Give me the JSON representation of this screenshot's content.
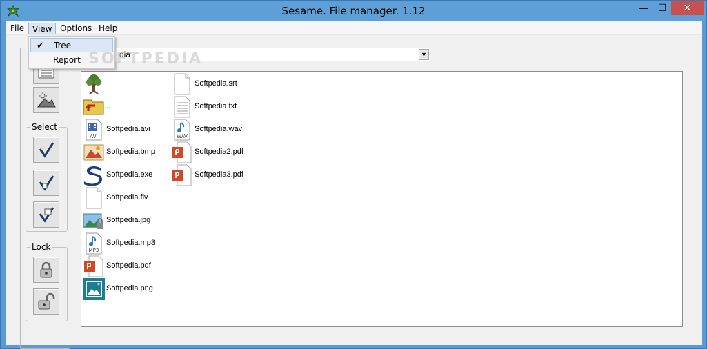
{
  "window": {
    "title": "Sesame. File manager. 1.12",
    "min_glyph": "—",
    "max_glyph": "☐",
    "close_glyph": "✕"
  },
  "menu": {
    "file": "File",
    "view": "View",
    "options": "Options",
    "help": "Help"
  },
  "view_menu": {
    "items": [
      {
        "label": "Tree",
        "checked": true,
        "highlighted": true
      },
      {
        "label": "Report",
        "checked": false,
        "highlighted": false
      }
    ],
    "check_glyph": "✔"
  },
  "sidebar": {
    "select_label": "Select",
    "lock_label": "Lock"
  },
  "path": {
    "value": "dia"
  },
  "watermark": "SOFTPEDIA",
  "files": [
    {
      "name": "",
      "icon": "tree-icon"
    },
    {
      "name": "..",
      "icon": "parent-folder-icon"
    },
    {
      "name": "Softpedia.avi",
      "icon": "avi-icon"
    },
    {
      "name": "Softpedia.bmp",
      "icon": "bmp-icon"
    },
    {
      "name": "Softpedia.exe",
      "icon": "exe-icon"
    },
    {
      "name": "Softpedia.flv",
      "icon": "blank-file-icon"
    },
    {
      "name": "Softpedia.jpg",
      "icon": "jpg-icon"
    },
    {
      "name": "Softpedia.mp3",
      "icon": "mp3-icon"
    },
    {
      "name": "Softpedia.pdf",
      "icon": "pdf-icon"
    },
    {
      "name": "Softpedia.png",
      "icon": "png-icon"
    },
    {
      "name": "Softpedia.srt",
      "icon": "blank-file-icon"
    },
    {
      "name": "Softpedia.txt",
      "icon": "text-file-icon"
    },
    {
      "name": "Softpedia.wav",
      "icon": "wav-icon"
    },
    {
      "name": "Softpedia2.pdf",
      "icon": "pdf-icon"
    },
    {
      "name": "Softpedia3.pdf",
      "icon": "pdf-icon"
    }
  ],
  "icon_labels": {
    "avi": "AVI",
    "mp3": "MP3",
    "wav": "WAV"
  },
  "colors": {
    "titlebar": "#5f9fd8",
    "close": "#c75050",
    "pdf": "#d24726",
    "exe": "#1a3c8c",
    "png": "#1b7f93"
  }
}
